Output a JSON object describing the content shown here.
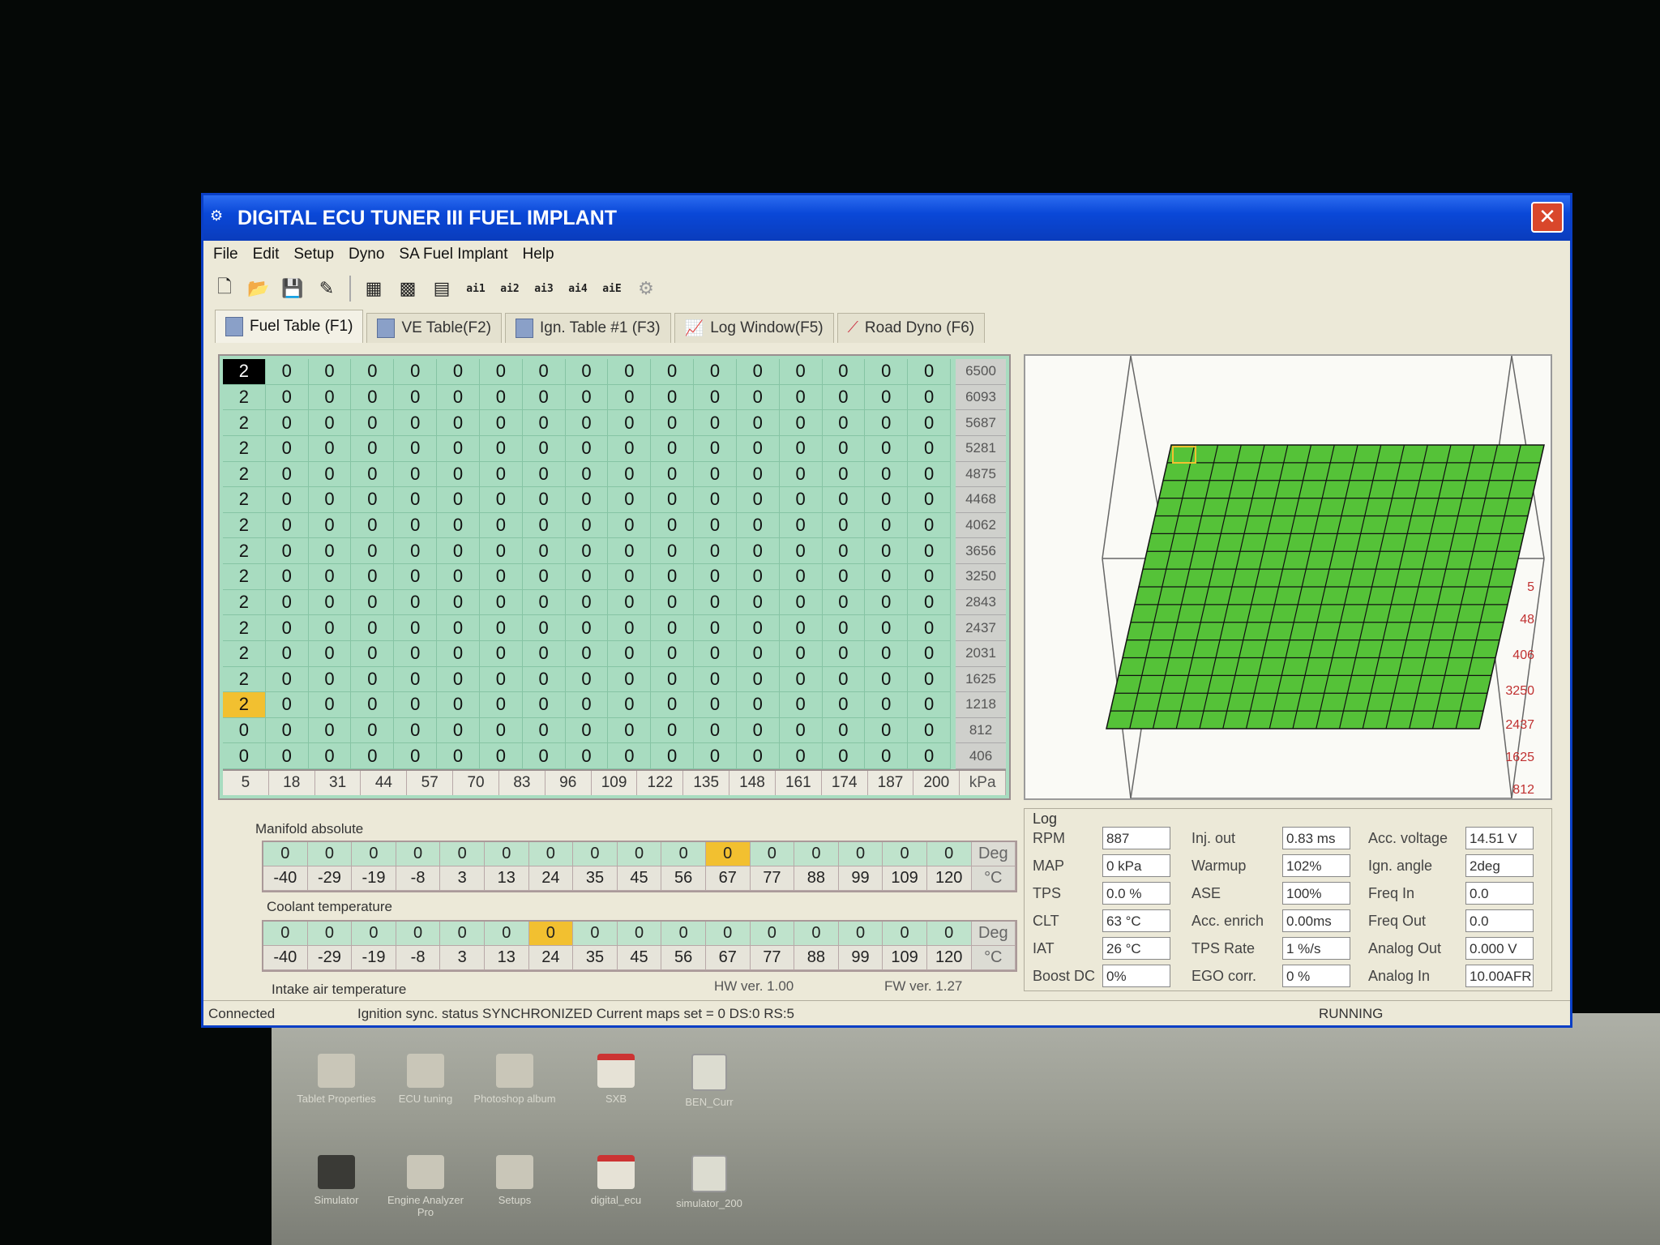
{
  "window": {
    "title": "DIGITAL ECU TUNER III FUEL IMPLANT",
    "close_glyph": "✕"
  },
  "menu": [
    "File",
    "Edit",
    "Setup",
    "Dyno",
    "SA Fuel Implant",
    "Help"
  ],
  "toolbar": {
    "icons": [
      "new-file-icon",
      "open-folder-icon",
      "save-icon",
      "edit-pencil-icon",
      "grid-view-icon",
      "grid-fine-icon",
      "table-grid-icon",
      "ai1-icon",
      "ai2-icon",
      "ai3-icon",
      "ai4-icon",
      "aie-icon",
      "settings-gear-icon"
    ],
    "grid_labels": {
      "ai1": "ai1",
      "ai2": "ai2",
      "ai3": "ai3",
      "ai4": "ai4",
      "aie": "aiE"
    }
  },
  "tabs": [
    {
      "label": "Fuel Table (F1)",
      "active": true
    },
    {
      "label": "VE Table(F2)",
      "active": false
    },
    {
      "label": "Ign. Table #1 (F3)",
      "active": false
    },
    {
      "label": "Log Window(F5)",
      "active": false
    },
    {
      "label": "Road Dyno (F6)",
      "active": false
    }
  ],
  "fuel_table": {
    "rpm_axis": [
      "6500",
      "6093",
      "5687",
      "5281",
      "4875",
      "4468",
      "4062",
      "3656",
      "3250",
      "2843",
      "2437",
      "2031",
      "1625",
      "1218",
      "812",
      "406"
    ],
    "kpa_axis": [
      "5",
      "18",
      "31",
      "44",
      "57",
      "70",
      "83",
      "96",
      "109",
      "122",
      "135",
      "148",
      "161",
      "174",
      "187",
      "200"
    ],
    "kpa_unit": "kPa",
    "first_column": [
      "2",
      "2",
      "2",
      "2",
      "2",
      "2",
      "2",
      "2",
      "2",
      "2",
      "2",
      "2",
      "2",
      "2",
      "0",
      "0"
    ],
    "fill_value": "0",
    "selected_row": 0,
    "live_row": 13,
    "axis_label": "Manifold absolute"
  },
  "coolant": {
    "label": "Coolant temperature",
    "values": [
      "0",
      "0",
      "0",
      "0",
      "0",
      "0",
      "0",
      "0",
      "0",
      "0",
      "0",
      "0",
      "0",
      "0",
      "0",
      "0"
    ],
    "unit_top": "Deg",
    "temps": [
      "-40",
      "-29",
      "-19",
      "-8",
      "3",
      "13",
      "24",
      "35",
      "45",
      "56",
      "67",
      "77",
      "88",
      "99",
      "109",
      "120"
    ],
    "unit_bottom": "°C",
    "live_index": 10
  },
  "intake": {
    "label": "Intake air temperature",
    "values": [
      "0",
      "0",
      "0",
      "0",
      "0",
      "0",
      "0",
      "0",
      "0",
      "0",
      "0",
      "0",
      "0",
      "0",
      "0",
      "0"
    ],
    "unit_top": "Deg",
    "temps": [
      "-40",
      "-29",
      "-19",
      "-8",
      "3",
      "13",
      "24",
      "35",
      "45",
      "56",
      "67",
      "77",
      "88",
      "99",
      "109",
      "120"
    ],
    "unit_bottom": "°C",
    "live_index": 6
  },
  "versions": {
    "hw": "HW ver. 1.00",
    "fw": "FW ver. 1.27"
  },
  "map3d": {
    "side_labels": [
      "5",
      "48",
      "406",
      "3250",
      "2437",
      "1625",
      "812"
    ],
    "surface_color": "#55c238",
    "grid_cols": 16,
    "grid_rows": 16
  },
  "log": {
    "title": "Log",
    "rpm": {
      "label": "RPM",
      "value": "887"
    },
    "map": {
      "label": "MAP",
      "value": "0 kPa"
    },
    "tps": {
      "label": "TPS",
      "value": "0.0 %"
    },
    "clt": {
      "label": "CLT",
      "value": "63 °C"
    },
    "iat": {
      "label": "IAT",
      "value": "26 °C"
    },
    "boost": {
      "label": "Boost DC",
      "value": "0%"
    },
    "inj_out": {
      "label": "Inj. out",
      "value": "0.83 ms"
    },
    "warmup": {
      "label": "Warmup",
      "value": "102%"
    },
    "ase": {
      "label": "ASE",
      "value": "100%"
    },
    "acc_enrich": {
      "label": "Acc. enrich",
      "value": "0.00ms"
    },
    "tps_rate": {
      "label": "TPS Rate",
      "value": "1 %/s"
    },
    "ego": {
      "label": "EGO corr.",
      "value": "0 %"
    },
    "acc_voltage": {
      "label": "Acc. voltage",
      "value": "14.51 V"
    },
    "ign_angle": {
      "label": "Ign. angle",
      "value": "2deg"
    },
    "freq_in": {
      "label": "Freq In",
      "value": "0.0"
    },
    "freq_out": {
      "label": "Freq Out",
      "value": "0.0"
    },
    "analog_out": {
      "label": "Analog Out",
      "value": "0.000 V"
    },
    "analog_in": {
      "label": "Analog In",
      "value": "10.00AFR"
    }
  },
  "status": {
    "connection": "Connected",
    "sync": "Ignition sync. status SYNCHRONIZED  Current maps set = 0  DS:0 RS:5",
    "state": "RUNNING"
  },
  "desktop_icons": [
    {
      "label": "Tablet Properties",
      "icon": "tablet-icon"
    },
    {
      "label": "ECU tuning",
      "icon": "folder-icon"
    },
    {
      "label": "Photoshop album",
      "icon": "folder-icon"
    },
    {
      "label": "SXB",
      "icon": "pdf-icon"
    },
    {
      "label": "BEN_Curr",
      "icon": "document-icon"
    },
    {
      "label": "Simulator",
      "icon": "chip-icon"
    },
    {
      "label": "Engine Analyzer Pro",
      "icon": "folder-icon"
    },
    {
      "label": "Setups",
      "icon": "folder-icon"
    },
    {
      "label": "digital_ecu",
      "icon": "pdf-icon"
    },
    {
      "label": "simulator_200",
      "icon": "document-icon"
    }
  ]
}
